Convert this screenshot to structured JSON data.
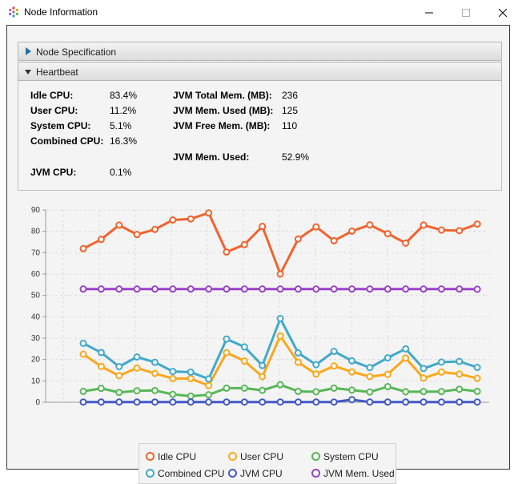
{
  "window": {
    "title": "Node Information"
  },
  "accordion": {
    "node_spec_label": "Node Specification",
    "heartbeat_label": "Heartbeat"
  },
  "heartbeat": {
    "idle_cpu_label": "Idle CPU:",
    "idle_cpu": "83.4%",
    "user_cpu_label": "User CPU:",
    "user_cpu": "11.2%",
    "system_cpu_label": "System CPU:",
    "system_cpu": "5.1%",
    "combined_cpu_label": "Combined CPU:",
    "combined_cpu": "16.3%",
    "jvm_cpu_label": "JVM CPU:",
    "jvm_cpu": "0.1%",
    "jvm_total_mem_label": "JVM Total Mem. (MB):",
    "jvm_total_mem": "236",
    "jvm_mem_used_mb_label": "JVM Mem. Used (MB):",
    "jvm_mem_used_mb": "125",
    "jvm_free_mem_label": "JVM Free Mem. (MB):",
    "jvm_free_mem": "110",
    "jvm_mem_used_label": "JVM Mem. Used:",
    "jvm_mem_used": "52.9%"
  },
  "chart_data": {
    "type": "line",
    "ylim": [
      0,
      90
    ],
    "yticks": [
      "0",
      "10",
      "20",
      "30",
      "40",
      "50",
      "60",
      "70",
      "80",
      "90"
    ],
    "grid": true,
    "legend_position": "bottom",
    "x": [
      1,
      2,
      3,
      4,
      5,
      6,
      7,
      8,
      9,
      10,
      11,
      12,
      13,
      14,
      15,
      16,
      17,
      18,
      19,
      20,
      21,
      22,
      23,
      24,
      25
    ],
    "series": [
      {
        "name": "Idle CPU",
        "color": "#f3622d",
        "values": [
          71.9,
          76.2,
          82.9,
          78.5,
          80.9,
          85.3,
          85.8,
          88.6,
          70.3,
          73.8,
          82.3,
          60.0,
          76.4,
          82.1,
          75.6,
          80.1,
          83.0,
          78.9,
          74.5,
          82.9,
          80.6,
          80.3,
          83.4
        ]
      },
      {
        "name": "User CPU",
        "color": "#fba71b",
        "values": [
          22.5,
          16.8,
          12.4,
          16.0,
          13.5,
          11.1,
          11.1,
          7.8,
          23.2,
          19.3,
          12.0,
          31.0,
          18.7,
          13.2,
          17.0,
          14.2,
          12.0,
          13.1,
          20.7,
          11.3,
          14.1,
          13.2,
          11.2
        ]
      },
      {
        "name": "System CPU",
        "color": "#57b757",
        "values": [
          5.1,
          6.5,
          4.6,
          5.4,
          5.5,
          3.7,
          2.9,
          3.5,
          6.6,
          6.6,
          5.6,
          8.2,
          5.1,
          4.9,
          6.6,
          5.7,
          4.8,
          7.3,
          4.9,
          5.0,
          5.0,
          6.1,
          5.1
        ]
      },
      {
        "name": "Combined CPU",
        "color": "#41a9c9",
        "values": [
          27.6,
          23.3,
          16.7,
          21.2,
          18.7,
          14.4,
          14.1,
          10.9,
          29.6,
          25.9,
          17.2,
          39.2,
          23.1,
          17.6,
          23.8,
          19.4,
          16.2,
          20.8,
          25.0,
          15.8,
          18.8,
          19.1,
          16.3
        ]
      },
      {
        "name": "JVM CPU",
        "color": "#4258c9",
        "values": [
          0.1,
          0.1,
          0.1,
          0.1,
          0.1,
          0.1,
          0.1,
          0.1,
          0.1,
          0.1,
          0.1,
          0.1,
          0.1,
          0.1,
          0.1,
          1.2,
          0.1,
          0.1,
          0.1,
          0.1,
          0.1,
          0.1,
          0.1
        ]
      },
      {
        "name": "JVM Mem. Used",
        "color": "#9a42c8",
        "values": [
          53,
          53,
          53,
          53,
          53,
          53,
          53,
          53,
          53,
          53,
          53,
          53,
          53,
          53,
          53,
          53,
          53,
          53,
          53,
          53,
          53,
          53,
          52.9
        ]
      }
    ]
  }
}
